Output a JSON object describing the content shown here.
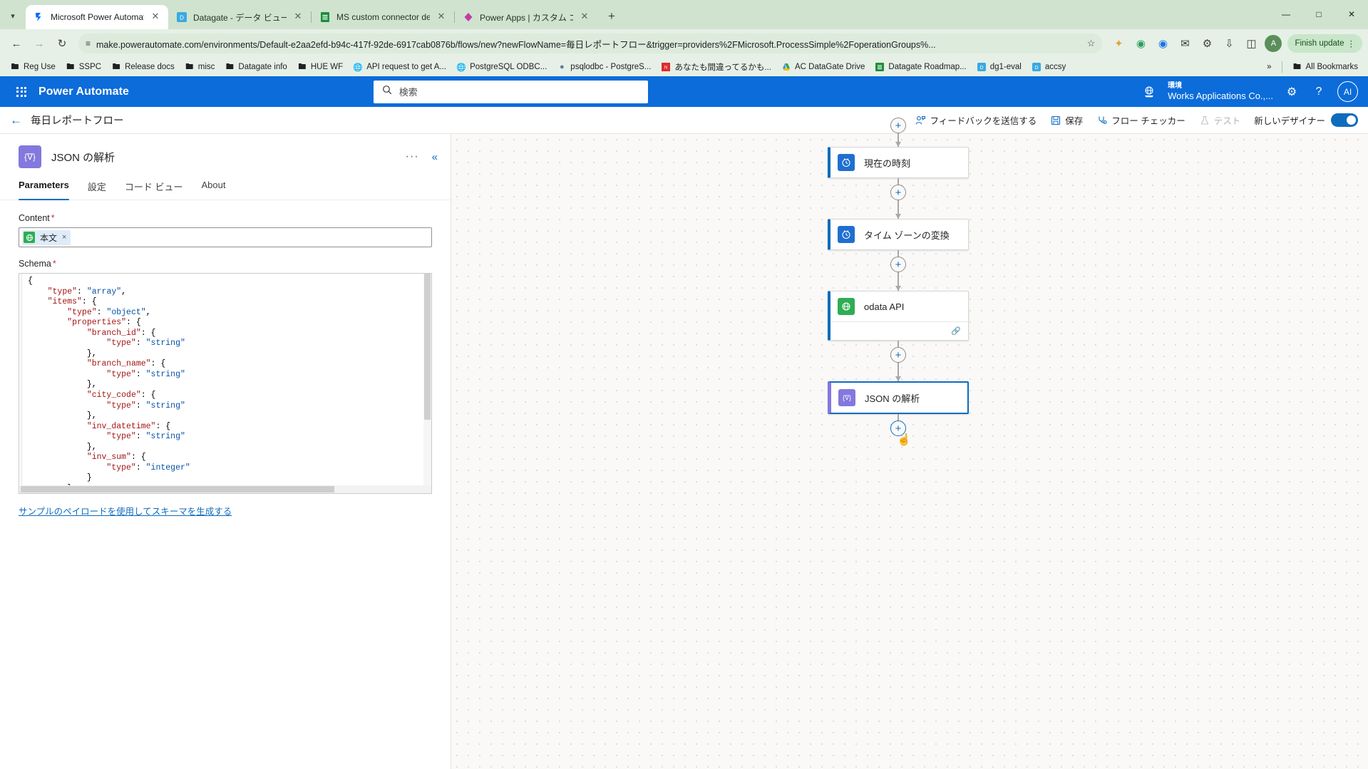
{
  "browser": {
    "tabs": [
      {
        "title": "Microsoft Power Automate",
        "icon": "power-automate-icon",
        "active": true
      },
      {
        "title": "Datagate - データ ビューアー",
        "icon": "datagate-icon",
        "active": false
      },
      {
        "title": "MS custom connector demo m",
        "icon": "sheets-icon",
        "active": false
      },
      {
        "title": "Power Apps | カスタム コネクタ",
        "icon": "power-apps-icon",
        "active": false
      }
    ],
    "new_tab_label": "+",
    "url": "make.powerautomate.com/environments/Default-e2aa2efd-b94c-417f-92de-6917cab0876b/flows/new?newFlowName=毎日レポートフロー&trigger=providers%2FMicrosoft.ProcessSimple%2FoperationGroups%...",
    "finish_update_label": "Finish update",
    "profile_initial": "A",
    "bookmarks": [
      {
        "label": "Reg Use",
        "icon": "folder-icon"
      },
      {
        "label": "SSPC",
        "icon": "folder-icon"
      },
      {
        "label": "Release docs",
        "icon": "folder-icon"
      },
      {
        "label": "misc",
        "icon": "folder-icon"
      },
      {
        "label": "Datagate info",
        "icon": "folder-icon"
      },
      {
        "label": "HUE WF",
        "icon": "folder-icon"
      },
      {
        "label": "API request to get A...",
        "icon": "globe-icon"
      },
      {
        "label": "PostgreSQL ODBC...",
        "icon": "globe-icon"
      },
      {
        "label": "psqlodbc - PostgreS...",
        "icon": "elephant-icon"
      },
      {
        "label": "あなたも間違ってるかも...",
        "icon": "next-icon"
      },
      {
        "label": "AC DataGate Drive",
        "icon": "drive-icon"
      },
      {
        "label": "Datagate Roadmap...",
        "icon": "sheets-icon"
      },
      {
        "label": "dg1-eval",
        "icon": "datagate-icon"
      },
      {
        "label": "accsy",
        "icon": "datagate-icon"
      }
    ],
    "overflow_label": "»",
    "all_bookmarks_label": "All Bookmarks"
  },
  "app": {
    "brand": "Power Automate",
    "search_placeholder": "検索",
    "environment_label": "環境",
    "environment_name": "Works Applications Co.,...",
    "avatar_initials": "AI"
  },
  "command_bar": {
    "flow_name": "毎日レポートフロー",
    "feedback_label": "フィードバックを送信する",
    "save_label": "保存",
    "flow_checker_label": "フロー チェッカー",
    "test_label": "テスト",
    "new_designer_label": "新しいデザイナー"
  },
  "panel": {
    "title": "JSON の解析",
    "icon": "json-parse-icon",
    "icon_glyph": "{∇}",
    "icon_color": "#8378de",
    "more_label": "···",
    "collapse_label": "«",
    "tabs": [
      {
        "label": "Parameters",
        "active": true
      },
      {
        "label": "設定",
        "active": false
      },
      {
        "label": "コード ビュー",
        "active": false
      },
      {
        "label": "About",
        "active": false
      }
    ],
    "content_field": {
      "label": "Content",
      "required": true,
      "token_label": "本文",
      "token_icon": "odata-api-icon",
      "token_remove": "×"
    },
    "schema_field": {
      "label": "Schema",
      "required": true,
      "code": "{\n    \"type\": \"array\",\n    \"items\": {\n        \"type\": \"object\",\n        \"properties\": {\n            \"branch_id\": {\n                \"type\": \"string\"\n            },\n            \"branch_name\": {\n                \"type\": \"string\"\n            },\n            \"city_code\": {\n                \"type\": \"string\"\n            },\n            \"inv_datetime\": {\n                \"type\": \"string\"\n            },\n            \"inv_sum\": {\n                \"type\": \"integer\"\n            }\n        },"
    },
    "sample_payload_link": "サンプルのペイロードを使用してスキーマを生成する"
  },
  "canvas": {
    "nodes": [
      {
        "label": "現在の時刻",
        "icon": "clock-icon",
        "icon_color": "#1f6fd0",
        "accent": "#0f6cbd",
        "selected": false,
        "has_footer": false
      },
      {
        "label": "タイム ゾーンの変換",
        "icon": "clock-icon",
        "icon_color": "#1f6fd0",
        "accent": "#0f6cbd",
        "selected": false,
        "has_footer": false
      },
      {
        "label": "odata API",
        "icon": "globe-icon",
        "icon_color": "#2fad53",
        "accent": "#0f6cbd",
        "selected": false,
        "has_footer": true,
        "footer_icon": "link-icon"
      },
      {
        "label": "JSON の解析",
        "icon": "json-parse-icon",
        "icon_color": "#8378de",
        "accent": "#8378de",
        "selected": true,
        "has_footer": false
      }
    ],
    "add_step_label": "+"
  }
}
